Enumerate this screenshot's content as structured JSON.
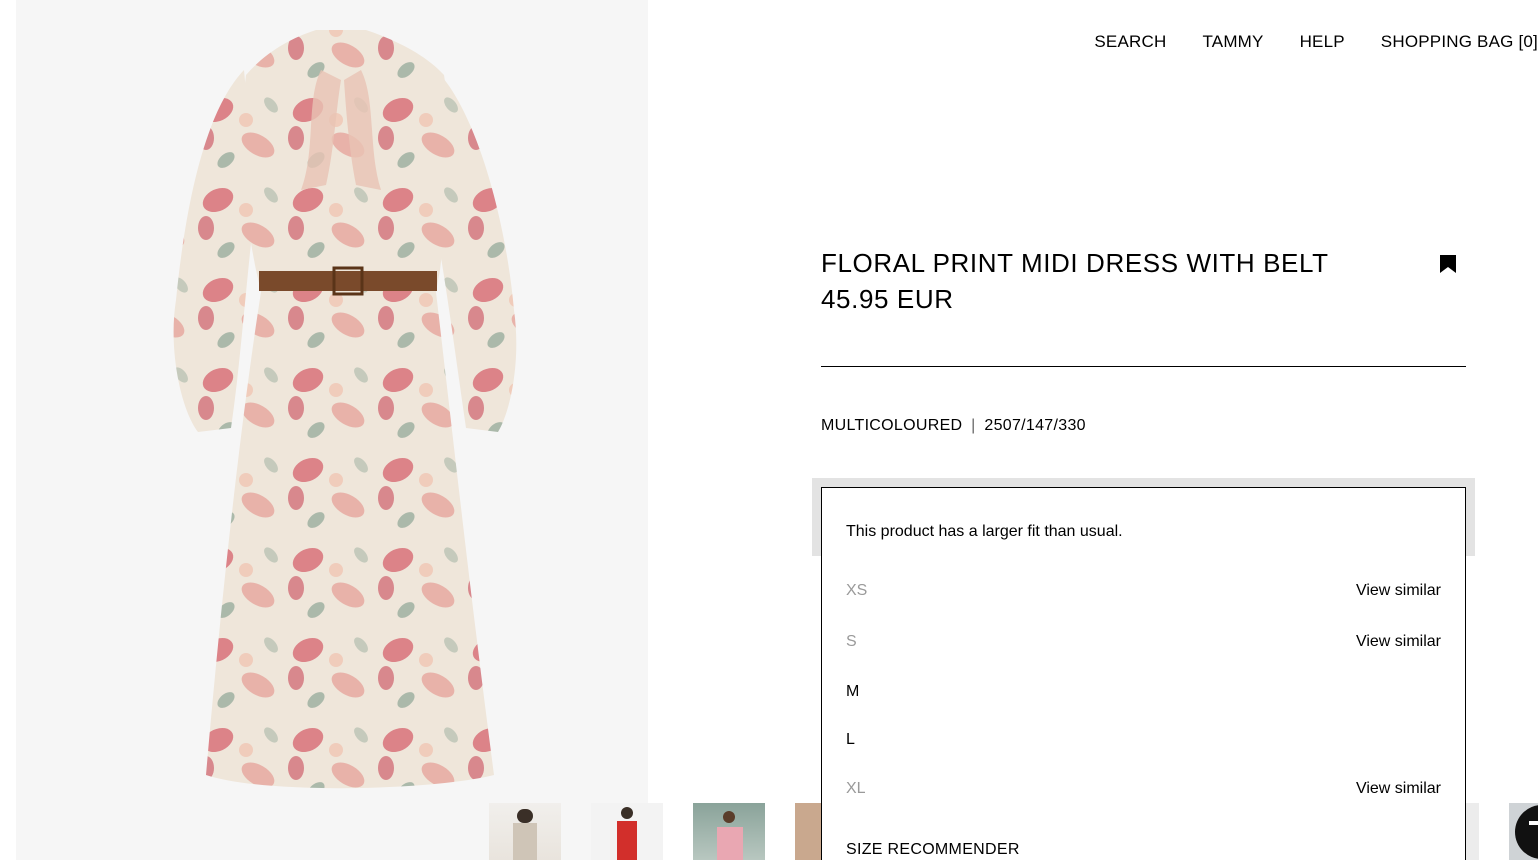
{
  "nav": {
    "search": "SEARCH",
    "user": "TAMMY",
    "help": "HELP",
    "bag": "SHOPPING BAG [0]"
  },
  "product": {
    "title": "FLORAL PRINT MIDI DRESS WITH BELT",
    "price": "45.95 EUR",
    "color": "MULTICOLOURED",
    "separator": "|",
    "reference": "2507/147/330"
  },
  "size_panel": {
    "fit_note": "This product has a larger fit than usual.",
    "sizes": [
      {
        "label": "XS",
        "available": false,
        "action": "View similar"
      },
      {
        "label": "S",
        "available": false,
        "action": "View similar"
      },
      {
        "label": "M",
        "available": true,
        "action": ""
      },
      {
        "label": "L",
        "available": true,
        "action": ""
      },
      {
        "label": "XL",
        "available": false,
        "action": "View similar"
      }
    ],
    "recommender": "SIZE RECOMMENDER"
  },
  "icons": {
    "bookmark": "bookmark-icon",
    "chat": "chat-icon"
  },
  "colors": {
    "accent": "#000000",
    "unavailable": "#9a9a9a",
    "image_bg": "#f6f6f6"
  }
}
